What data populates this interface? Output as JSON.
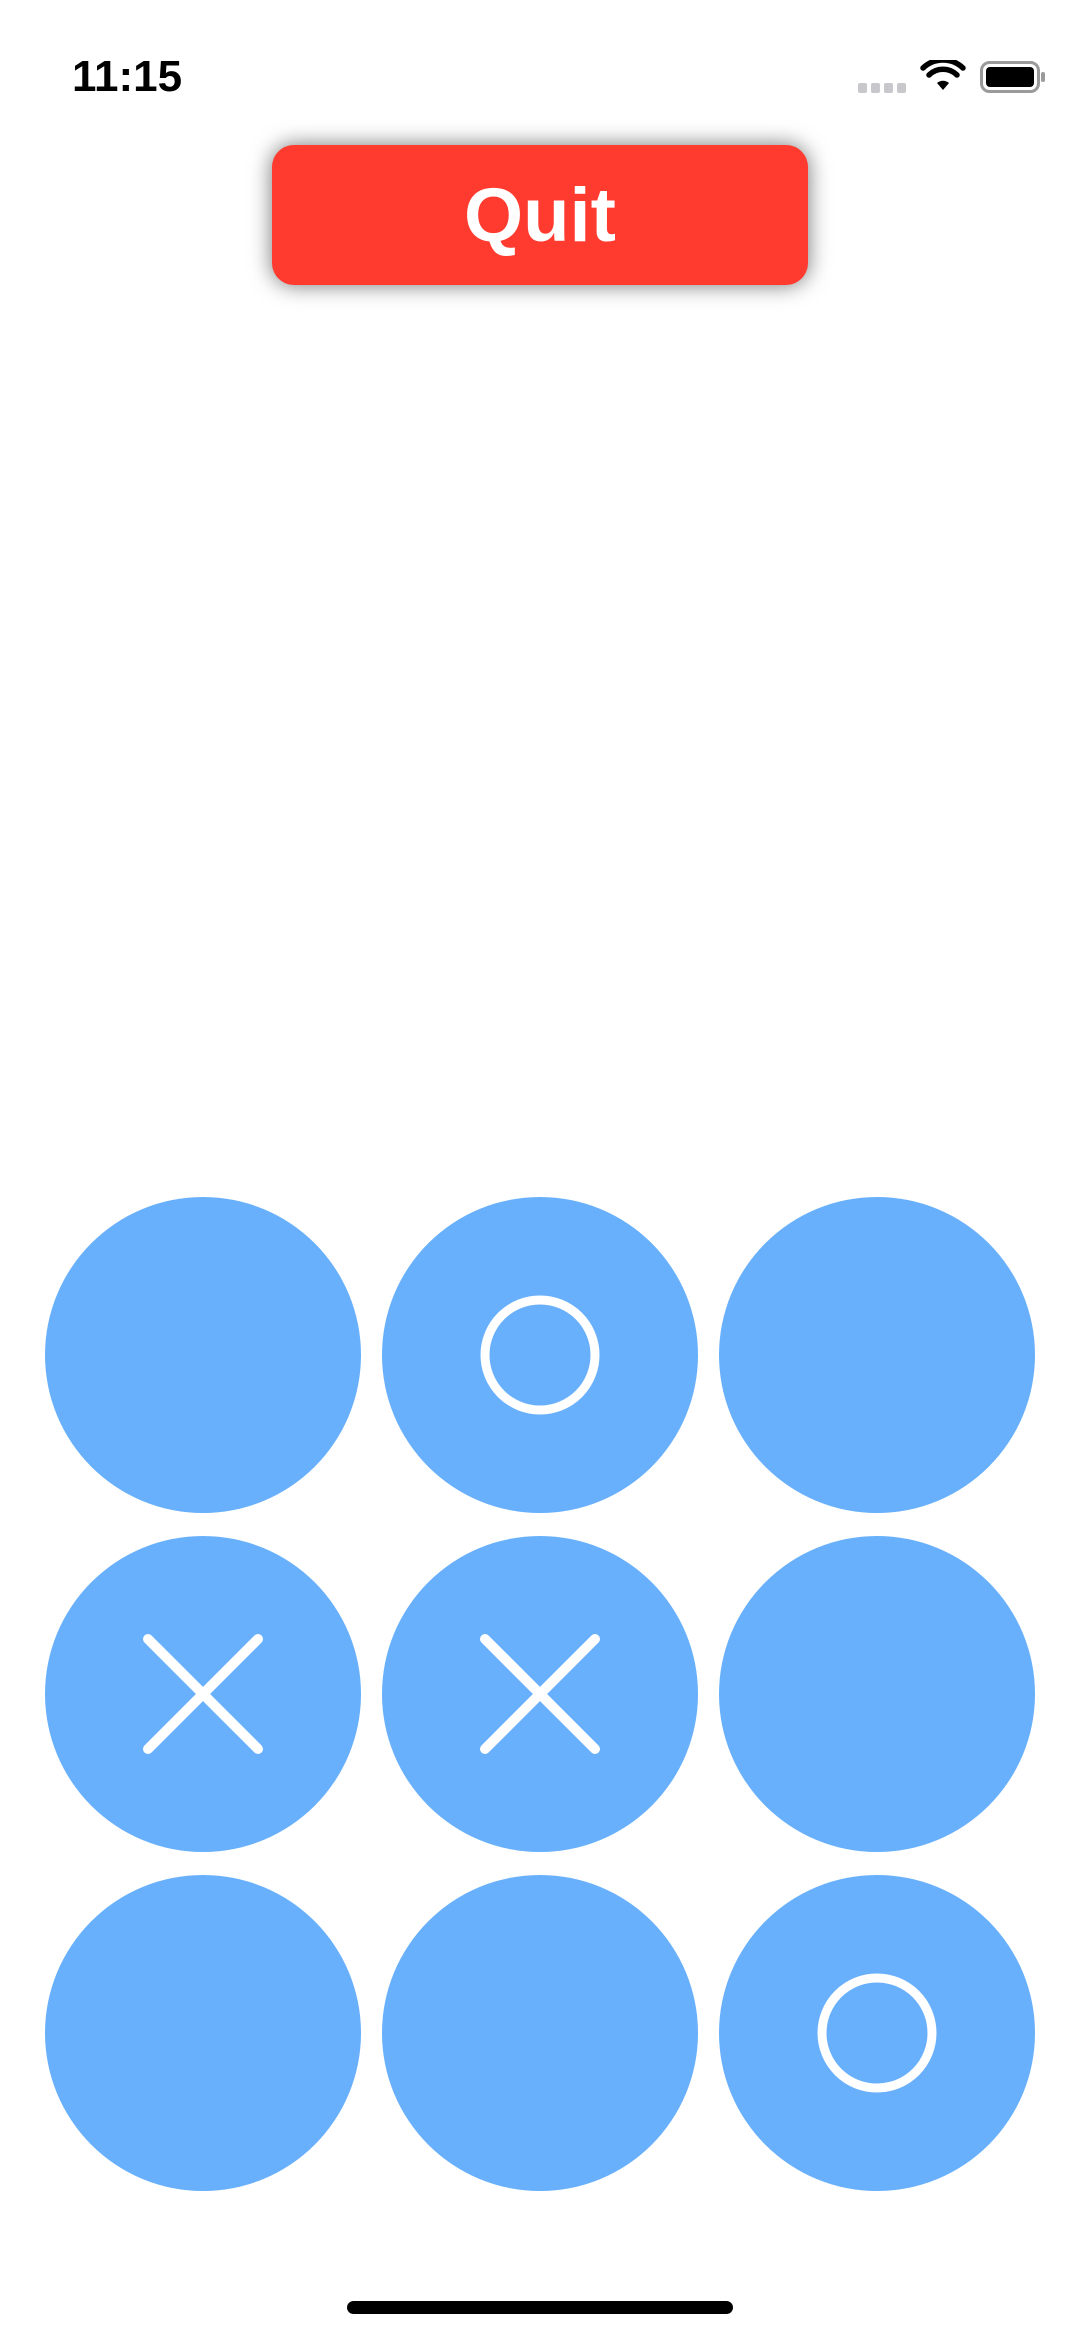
{
  "status_bar": {
    "time": "11:15",
    "signal_icon": "cellular-signal-icon",
    "wifi_icon": "wifi-icon",
    "battery_icon": "battery-icon"
  },
  "quit_button": {
    "label": "Quit",
    "color": "#ff3b30"
  },
  "board": {
    "cell_color": "#68b0fc",
    "mark_color": "#ffffff",
    "cells": [
      "",
      "O",
      "",
      "X",
      "X",
      "",
      "",
      "",
      "O"
    ]
  }
}
